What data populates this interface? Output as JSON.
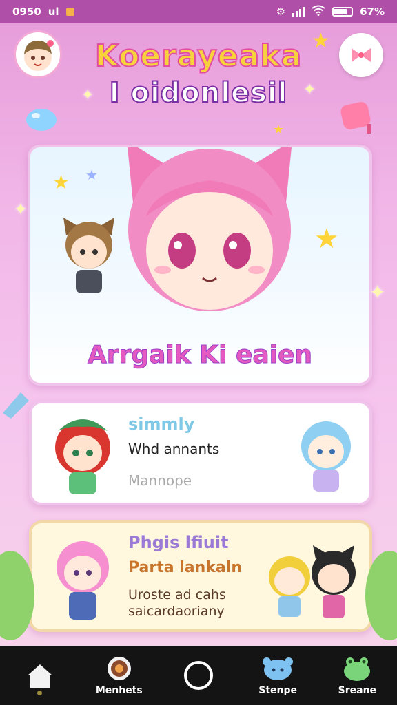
{
  "status_bar": {
    "time": "0950",
    "carrier": "ul",
    "battery_text": "67%"
  },
  "header": {
    "title_line1": "Koerayeaka",
    "title_line2": "I oidonlesil",
    "avatar_icon": "chibi-boy-avatar",
    "menu_icon": "bow-menu-icon"
  },
  "hero_card": {
    "caption": "Arrgaik Ki eaien",
    "character": "pink-hair-cat-girl"
  },
  "card_2": {
    "title": "simmly",
    "line": "Whd annants",
    "subtitle": "Mannope"
  },
  "card_3": {
    "title": "Phgis lfiuit",
    "line": "Parta lankaln",
    "desc_line1": "Uroste ad cahs",
    "desc_line2": "saicardaoriany"
  },
  "bottom_nav": {
    "items": [
      {
        "label": "",
        "icon": "home-icon",
        "active": true
      },
      {
        "label": "Menhets",
        "icon": "ramen-icon"
      },
      {
        "label": "",
        "icon": "circle-icon"
      },
      {
        "label": "Stenpe",
        "icon": "blue-slime-icon"
      },
      {
        "label": "Sreane",
        "icon": "green-frog-icon"
      }
    ]
  },
  "colors": {
    "accent": "#e55ac1",
    "title_yellow": "#f7d23c",
    "status_bar": "#b04fa8",
    "nav_background": "#141414"
  }
}
